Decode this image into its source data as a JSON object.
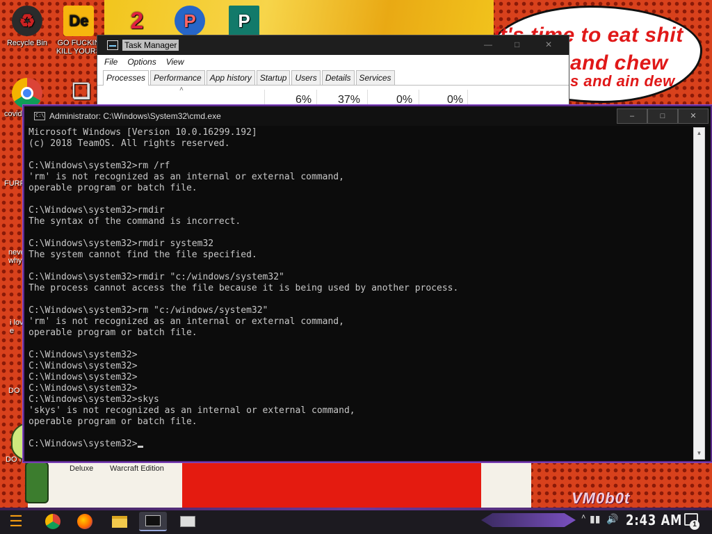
{
  "desktop": {
    "icons": [
      {
        "label": "Recycle Bin",
        "icon": "recycle-bin-icon"
      },
      {
        "label": "GO FUCKIN KILL YOURS",
        "icon": "de-app-icon"
      },
      {
        "label": "",
        "icon": "chrome-icon"
      },
      {
        "label": "covid booste",
        "icon": "document-icon"
      }
    ],
    "partial_labels": [
      "FURR",
      "neve why",
      "i lov e",
      "DO I",
      "DO I"
    ],
    "below_cmd_labels": [
      "Deluxe",
      "Warcraft Edition"
    ]
  },
  "wallpaper": {
    "bubble_lines": [
      "it's time to eat shit",
      "and chew",
      "s and ain dew"
    ],
    "watermark": "VM0b0t"
  },
  "task_manager": {
    "title": "Task Manager",
    "menu": [
      "File",
      "Options",
      "View"
    ],
    "tabs": [
      "Processes",
      "Performance",
      "App history",
      "Startup",
      "Users",
      "Details",
      "Services"
    ],
    "active_tab": "Processes",
    "columns": [
      "6%",
      "37%",
      "0%",
      "0%"
    ]
  },
  "cmd": {
    "title": "Administrator: C:\\Windows\\System32\\cmd.exe",
    "lines": [
      "Microsoft Windows [Version 10.0.16299.192]",
      "(c) 2018 TeamOS. All rights reserved.",
      "",
      "C:\\Windows\\system32>rm /rf",
      "'rm' is not recognized as an internal or external command,",
      "operable program or batch file.",
      "",
      "C:\\Windows\\system32>rmdir",
      "The syntax of the command is incorrect.",
      "",
      "C:\\Windows\\system32>rmdir system32",
      "The system cannot find the file specified.",
      "",
      "C:\\Windows\\system32>rmdir \"c:/windows/system32\"",
      "The process cannot access the file because it is being used by another process.",
      "",
      "C:\\Windows\\system32>rm \"c:/windows/system32\"",
      "'rm' is not recognized as an internal or external command,",
      "operable program or batch file.",
      "",
      "C:\\Windows\\system32>",
      "C:\\Windows\\system32>",
      "C:\\Windows\\system32>",
      "C:\\Windows\\system32>",
      "C:\\Windows\\system32>skys",
      "'skys' is not recognized as an internal or external command,",
      "operable program or batch file.",
      "",
      "C:\\Windows\\system32>"
    ],
    "buttons": {
      "minimize": "–",
      "maximize": "□",
      "close": "✕"
    }
  },
  "taskbar": {
    "apps": [
      {
        "icon": "chrome-icon",
        "active": false
      },
      {
        "icon": "firefox-icon",
        "active": false
      },
      {
        "icon": "file-explorer-icon",
        "active": false
      },
      {
        "icon": "cmd-icon",
        "active": true
      },
      {
        "icon": "task-manager-icon",
        "active": false
      }
    ],
    "clock": "2:43 AM",
    "notification_count": "1"
  },
  "colors": {
    "cmd_bg": "#0c0c0c",
    "cmd_text": "#c8c8c8",
    "accent_purple": "#8d4fd0",
    "wallpaper_red": "#d8411c"
  }
}
